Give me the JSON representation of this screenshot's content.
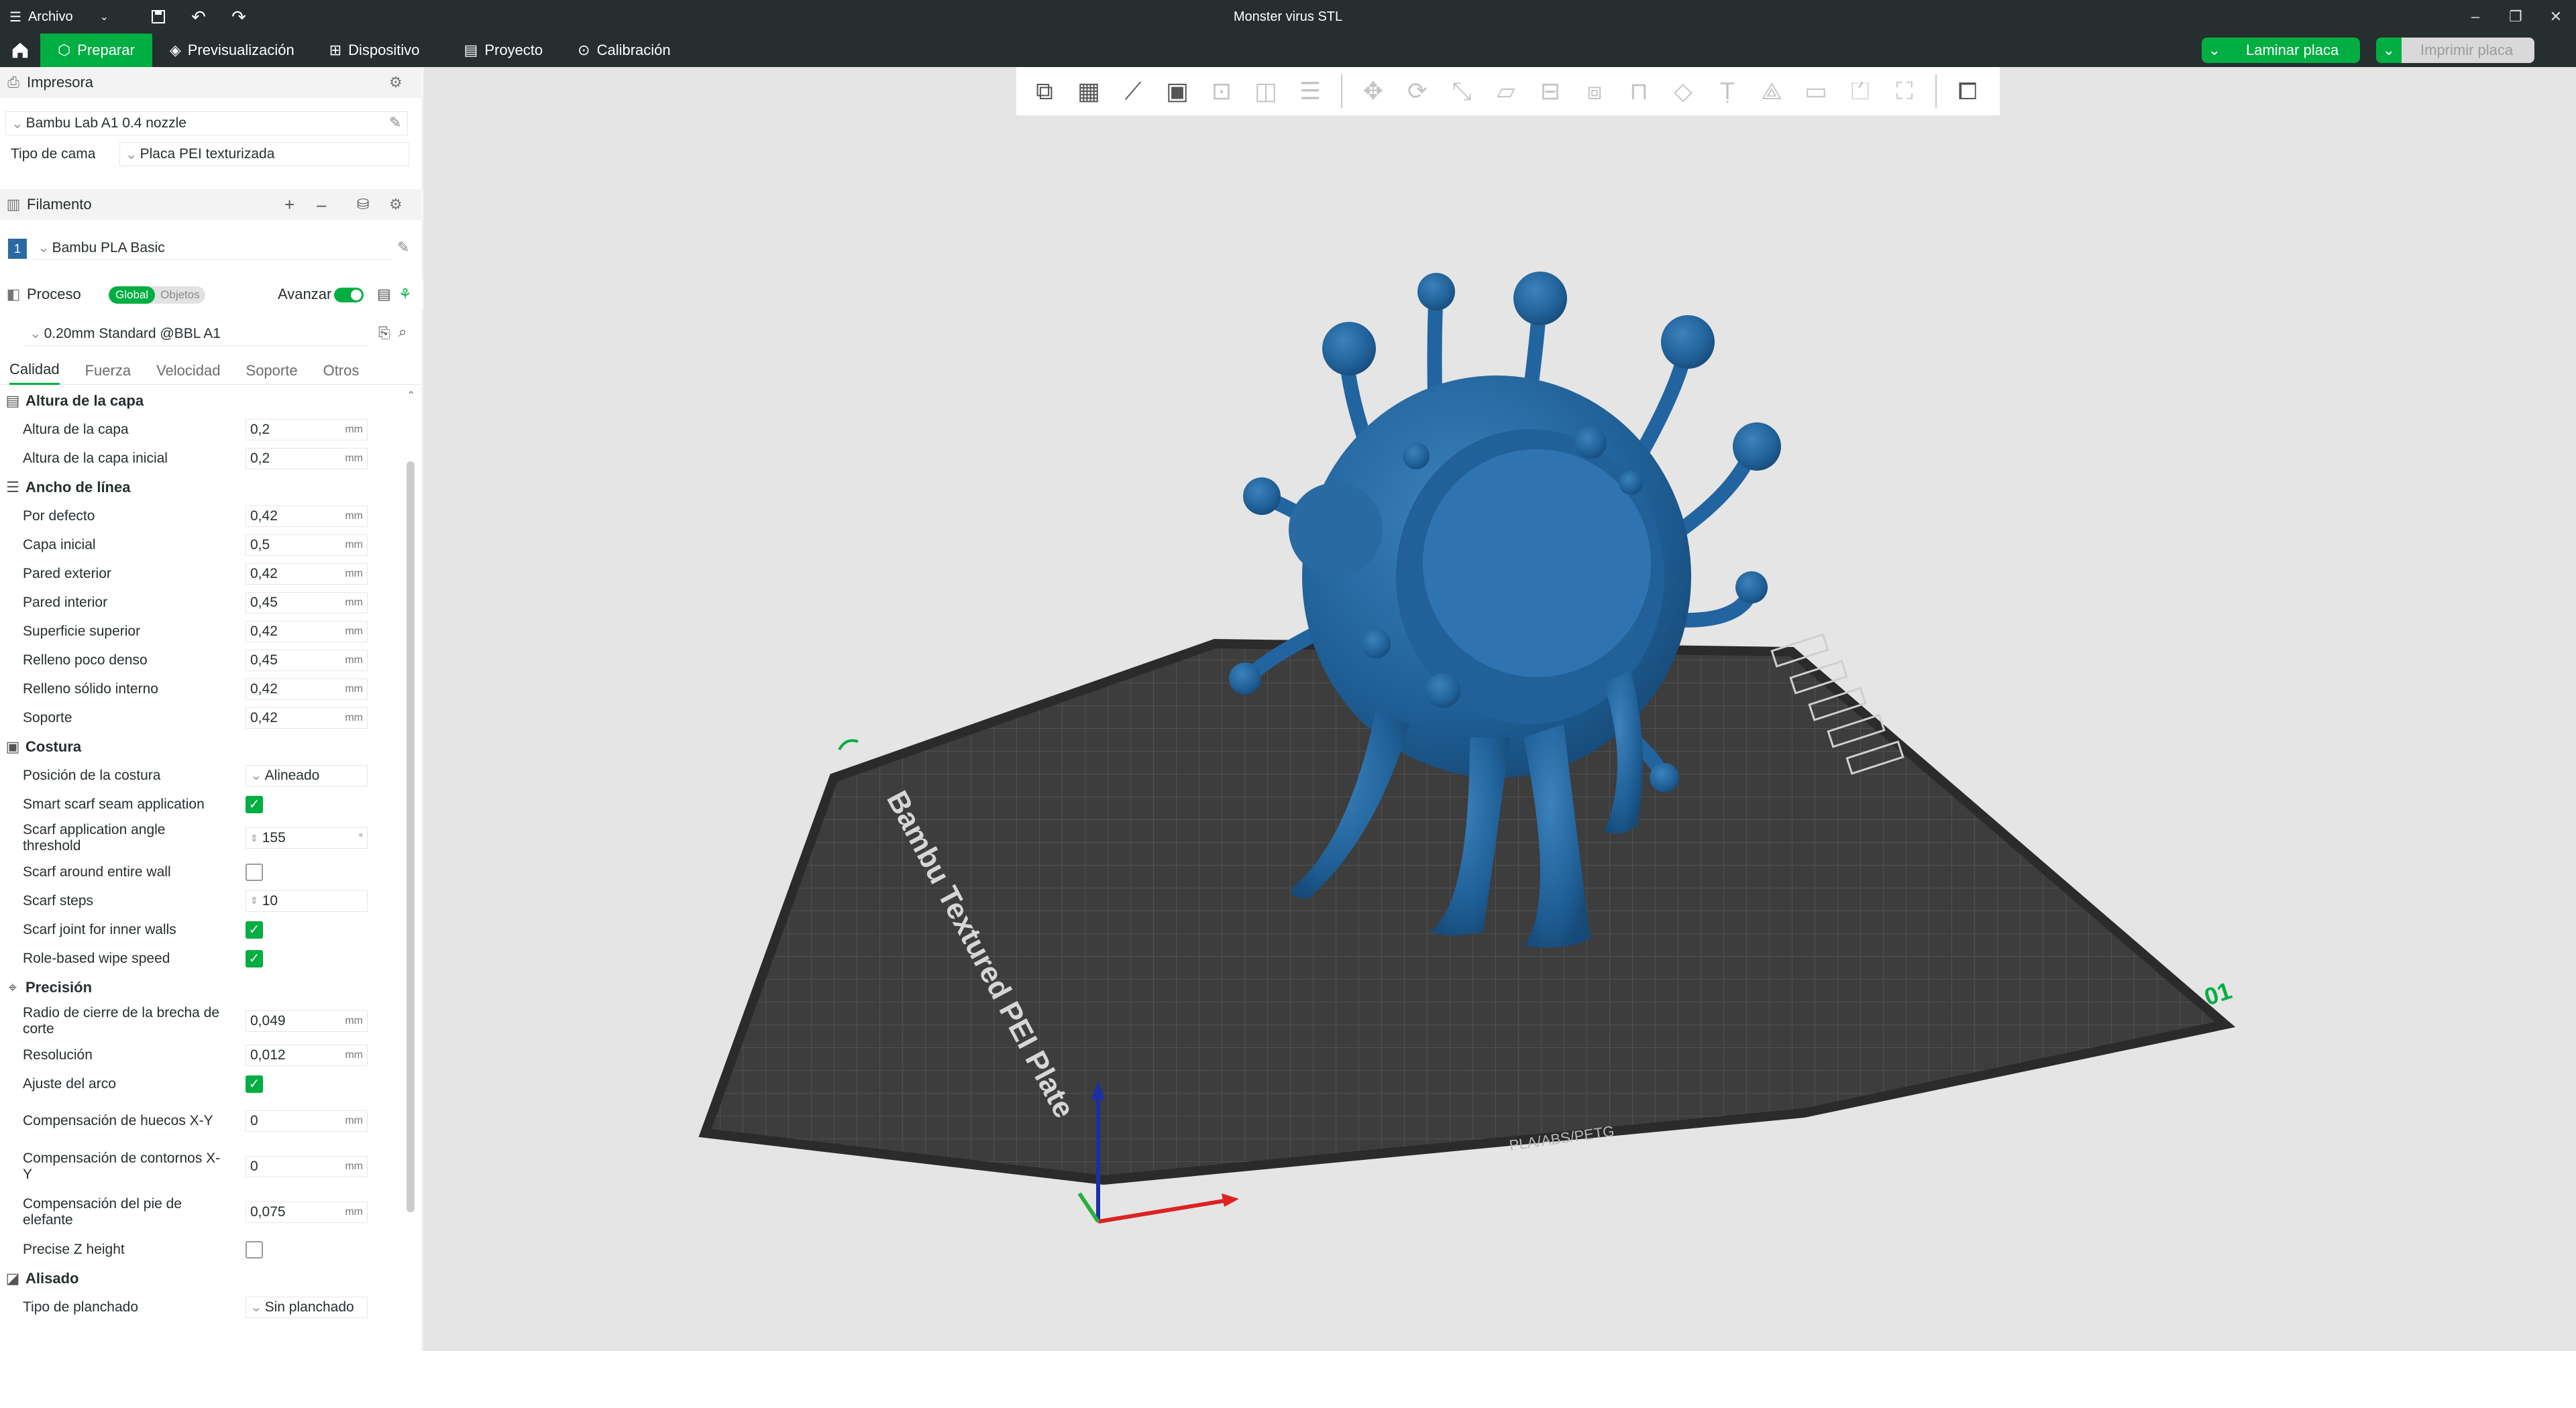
{
  "app": {
    "title": "Monster virus STL",
    "menu_label": "Archivo"
  },
  "nav": {
    "tabs": [
      "Preparar",
      "Previsualización",
      "Dispositivo",
      "Proyecto",
      "Calibración"
    ],
    "slice_button": "Laminar placa",
    "print_button": "Imprimir placa"
  },
  "printer": {
    "section": "Impresora",
    "name": "Bambu Lab A1 0.4 nozzle",
    "bed_label": "Tipo de cama",
    "bed_value": "Placa PEI texturizada"
  },
  "filament": {
    "section": "Filamento",
    "index": "1",
    "name": "Bambu PLA Basic"
  },
  "process": {
    "section": "Proceso",
    "toggle_global": "Global",
    "toggle_objects": "Objetos",
    "advance_label": "Avanzar",
    "preset": "0.20mm Standard @BBL A1"
  },
  "tabs": [
    "Calidad",
    "Fuerza",
    "Velocidad",
    "Soporte",
    "Otros"
  ],
  "groups": {
    "layer": {
      "title": "Altura de la capa",
      "rows": [
        {
          "label": "Altura de la capa",
          "value": "0,2",
          "unit": "mm"
        },
        {
          "label": "Altura de la capa inicial",
          "value": "0,2",
          "unit": "mm"
        }
      ]
    },
    "line": {
      "title": "Ancho de línea",
      "rows": [
        {
          "label": "Por defecto",
          "value": "0,42",
          "unit": "mm"
        },
        {
          "label": "Capa inicial",
          "value": "0,5",
          "unit": "mm"
        },
        {
          "label": "Pared exterior",
          "value": "0,42",
          "unit": "mm"
        },
        {
          "label": "Pared interior",
          "value": "0,45",
          "unit": "mm"
        },
        {
          "label": "Superficie superior",
          "value": "0,42",
          "unit": "mm"
        },
        {
          "label": "Relleno poco denso",
          "value": "0,45",
          "unit": "mm"
        },
        {
          "label": "Relleno sólido interno",
          "value": "0,42",
          "unit": "mm"
        },
        {
          "label": "Soporte",
          "value": "0,42",
          "unit": "mm"
        }
      ]
    },
    "seam": {
      "title": "Costura",
      "position_label": "Posición de la costura",
      "position_value": "Alineado",
      "smart_label": "Smart scarf seam application",
      "angle_label": "Scarf application angle threshold",
      "angle_value": "155",
      "angle_unit": "°",
      "around_label": "Scarf around entire wall",
      "steps_label": "Scarf steps",
      "steps_value": "10",
      "inner_label": "Scarf joint for inner walls",
      "wipe_label": "Role-based wipe speed"
    },
    "precision": {
      "title": "Precisión",
      "gap_label": "Radio de cierre de la brecha de corte",
      "gap_value": "0,049",
      "res_label": "Resolución",
      "res_value": "0,012",
      "arc_label": "Ajuste del arco",
      "hole_label": "Compensación de huecos X-Y",
      "hole_value": "0",
      "contour_label": "Compensación de contornos X-Y",
      "contour_value": "0",
      "elephant_label": "Compensación del pie de elefante",
      "elephant_value": "0,075",
      "z_label": "Precise Z height",
      "unit": "mm"
    },
    "ironing": {
      "title": "Alisado",
      "type_label": "Tipo de planchado",
      "type_value": "Sin planchado"
    }
  },
  "plate": {
    "name": "Bambu Textured PEI Plate",
    "plate_number": "01",
    "filaments": "PLA/ABS/PETG"
  },
  "colors": {
    "accent": "#00ae42",
    "header": "#262e30",
    "model": "#2a6aa2",
    "plate": "#3a3a3a"
  }
}
